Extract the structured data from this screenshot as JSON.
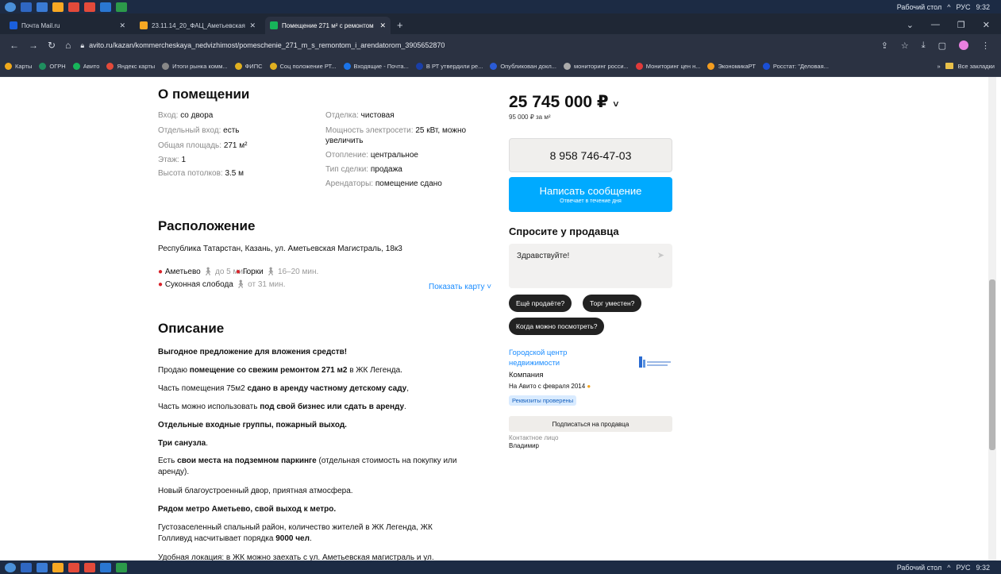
{
  "taskbar": {
    "top_icon_colors": [
      "#4a90d9",
      "#2f67c2",
      "#f7a823",
      "#3a7bd5",
      "#e34a3a",
      "#e34a3a",
      "#2a77d2",
      "#2c9a4a"
    ],
    "desktop_label": "Рабочий стол",
    "lang": "РУС",
    "time": "9:32"
  },
  "tabs": [
    {
      "label": "Почта Mail.ru",
      "fav_color": "#1a5fdc"
    },
    {
      "label": "23.11.14_20_ФАЦ_Аметьевская",
      "fav_color": "#f7a823"
    },
    {
      "label": "Помещение 271 м² с ремонтом",
      "fav_color": "#17b55a"
    }
  ],
  "new_tab": "+",
  "address": {
    "url": "avito.ru/kazan/kommercheskaya_nedvizhimost/pomeschenie_271_m_s_remontom_i_arendatorom_3905652870"
  },
  "bookmarks": [
    {
      "label": "Карты",
      "color": "#f0a91b"
    },
    {
      "label": "ОГРН",
      "color": "#1f8f5f"
    },
    {
      "label": "Авито",
      "color": "#17b55a"
    },
    {
      "label": "Яндекс карты",
      "color": "#e34a3a"
    },
    {
      "label": "Итоги рынка комм...",
      "color": "#888888"
    },
    {
      "label": "ФИПС",
      "color": "#e0b020"
    },
    {
      "label": "Соц положение РТ...",
      "color": "#e0b020"
    },
    {
      "label": "Входящие - Почта...",
      "color": "#1a73e8"
    },
    {
      "label": "В РТ утвердили ре...",
      "color": "#1a3fa8"
    },
    {
      "label": "Опубликован докл...",
      "color": "#2a5bd7"
    },
    {
      "label": "мониторинг росси...",
      "color": "#aaaaaa"
    },
    {
      "label": "Мониторинг цен н...",
      "color": "#e03a3a"
    },
    {
      "label": "ЭкономикаРТ",
      "color": "#f29c1f"
    },
    {
      "label": "Росстат: \"Деловая...",
      "color": "#1a4fd6"
    }
  ],
  "bookmarks_more": "»",
  "bookmarks_all": "Все закладки",
  "about": {
    "title": "О помещении",
    "left": [
      {
        "label": "Вход:",
        "value": "со двора"
      },
      {
        "label": "Отдельный вход:",
        "value": "есть"
      },
      {
        "label": "Общая площадь:",
        "value": "271 м²"
      },
      {
        "label": "Этаж:",
        "value": "1"
      },
      {
        "label": "Высота потолков:",
        "value": "3.5 м"
      }
    ],
    "right": [
      {
        "label": "Отделка:",
        "value": "чистовая"
      },
      {
        "label": "Мощность электросети:",
        "value": "25 кВт, можно увеличить"
      },
      {
        "label": "Отопление:",
        "value": "центральное"
      },
      {
        "label": "Тип сделки:",
        "value": "продажа"
      },
      {
        "label": "Арендаторы:",
        "value": "помещение сдано"
      }
    ]
  },
  "location": {
    "title": "Расположение",
    "address": "Республика Татарстан, Казань, ул. Аметьевская Магистраль, 18к3",
    "metro": [
      {
        "name": "Аметьево",
        "time": "до 5 мин."
      },
      {
        "name": "Горки",
        "time": "16–20 мин."
      },
      {
        "name": "Суконная слобода",
        "time": "от 31 мин."
      }
    ],
    "show_map": "Показать карту"
  },
  "description": {
    "title": "Описание",
    "p1": "Выгодное предложение для вложения средств!",
    "p2a": "Продаю ",
    "p2b": "помещение со свежим ремонтом 271 м2",
    "p2c": " в ЖК Легенда.",
    "p3a": "Часть помещения 75м2 ",
    "p3b": "сдано в аренду частному детскому саду",
    "p3c": ",",
    "p4a": "Часть можно использовать ",
    "p4b": "под свой бизнес или сдать в аренду",
    "p4c": ".",
    "p5": "Отдельные входные группы, пожарный выход.",
    "p6a": "Три санузла",
    "p6b": ".",
    "p7a": "Есть ",
    "p7b": "свои места на подземном паркинге",
    "p7c": " (отдельная стоимость на покупку или аренду).",
    "p8": "Новый благоустроенный двор, приятная атмосфера.",
    "p9": "Рядом метро Аметьево, свой выход к метро.",
    "p10a": "Густозаселенный спальный район, количество жителей в ЖК Легенда, ЖК Голливуд насчитывает порядка ",
    "p10b": "9000 чел",
    "p10c": ".",
    "p11": "Удобная локация: в ЖК можно заехать с ул. Аметьевская магистраль и ул."
  },
  "sidebar": {
    "price": "25 745 000 ₽",
    "price_per_m2": "95 000 ₽ за м²",
    "phone": "8 958 746-47-03",
    "message_btn": "Написать сообщение",
    "message_sub": "Отвечает в течение дня",
    "ask_title": "Спросите у продавца",
    "ask_placeholder": "Здравствуйте!",
    "chips": [
      "Ещё продаёте?",
      "Торг уместен?",
      "Когда можно посмотреть?"
    ],
    "seller_name": "Городской центр недвижимости",
    "seller_type": "Компания",
    "seller_since": "На Авито с февраля 2014",
    "verified": "Реквизиты проверены",
    "subscribe": "Подписаться на продавца",
    "contact_label": "Контактное лицо",
    "contact_name": "Владимир"
  },
  "scroll": {
    "position": 0.42
  }
}
